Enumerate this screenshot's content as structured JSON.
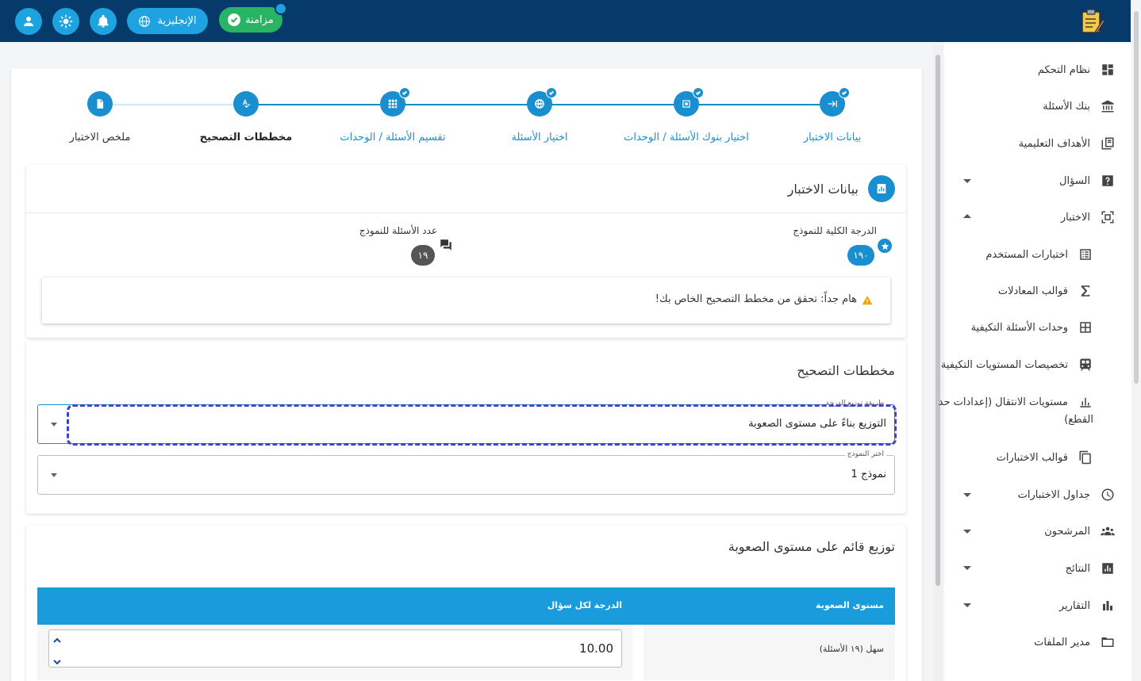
{
  "topbar": {
    "language_label": "الإنجليزية",
    "sync_label": "مزامنة"
  },
  "sidebar": {
    "items": [
      {
        "label": "نظام التحكم",
        "icon": "dashboard-icon"
      },
      {
        "label": "بنك الأسئلة",
        "icon": "bank-icon"
      },
      {
        "label": "الأهداف التعليمية",
        "icon": "book-icon"
      },
      {
        "label": "السؤال",
        "icon": "question-icon"
      },
      {
        "label": "الاختبار",
        "icon": "exam-icon"
      },
      {
        "label": "اختبارات المستخدم",
        "icon": "list-icon"
      },
      {
        "label": "قوالب المعادلات",
        "icon": "sigma-icon"
      },
      {
        "label": "وحدات الأسئلة التكيفية",
        "icon": "grid-icon"
      },
      {
        "label": "تخصيصات المستويات التكيفية",
        "icon": "train-icon"
      },
      {
        "label": "مستويات الانتقال (إعدادات حد",
        "label2": "القطع)",
        "icon": "bar-icon"
      },
      {
        "label": "قوالب الاختبارات",
        "icon": "copy-icon"
      },
      {
        "label": "جداول الاختبارات",
        "icon": "clock-icon"
      },
      {
        "label": "المرشحون",
        "icon": "people-icon"
      },
      {
        "label": "النتائج",
        "icon": "results-icon"
      },
      {
        "label": "التقارير",
        "icon": "chart-icon"
      },
      {
        "label": "مدير الملفات",
        "icon": "folder-icon"
      }
    ]
  },
  "stepper": {
    "steps": [
      {
        "label": "بيانات الاختبار",
        "state": "done"
      },
      {
        "label": "اختيار بنوك الأسئلة / الوحدات",
        "state": "done"
      },
      {
        "label": "اختيار الأسئلة",
        "state": "done"
      },
      {
        "label": "تقسيم الأسئلة / الوحدات",
        "state": "done"
      },
      {
        "label": "مخططات التصحيح",
        "state": "active"
      },
      {
        "label": "ملخص الاختبار",
        "state": "pending"
      }
    ]
  },
  "exam_data": {
    "title": "بيانات الاختبار",
    "total_score_label": "الدرجة الكلية للنموذج",
    "total_score_value": "١٩٠",
    "question_count_label": "عدد الأسئلة للنموذج",
    "question_count_value": "١٩",
    "alert_text": "هام جداً: تحقق من مخطط التصحيح الخاص بك!"
  },
  "grading": {
    "title": "مخططات التصحيح",
    "method_legend": "طريقة توزيع الدرجة",
    "method_value": "التوزيع بناءً على مستوى الصعوبة",
    "model_legend": "اختر النموذج",
    "model_value": "نموذج 1"
  },
  "difficulty": {
    "title": "توزيع قائم على مستوى الصعوبة",
    "col_level": "مستوى الصعوبة",
    "col_score": "الدرجة لكل سؤال",
    "rows": [
      {
        "level": "سهل (١٩ الأسئلة)",
        "score": "10.00"
      }
    ]
  },
  "colors": {
    "header": "#063a6b",
    "accent": "#1a8fd0",
    "sync": "#28b463",
    "table_header": "#1a9bdc"
  }
}
